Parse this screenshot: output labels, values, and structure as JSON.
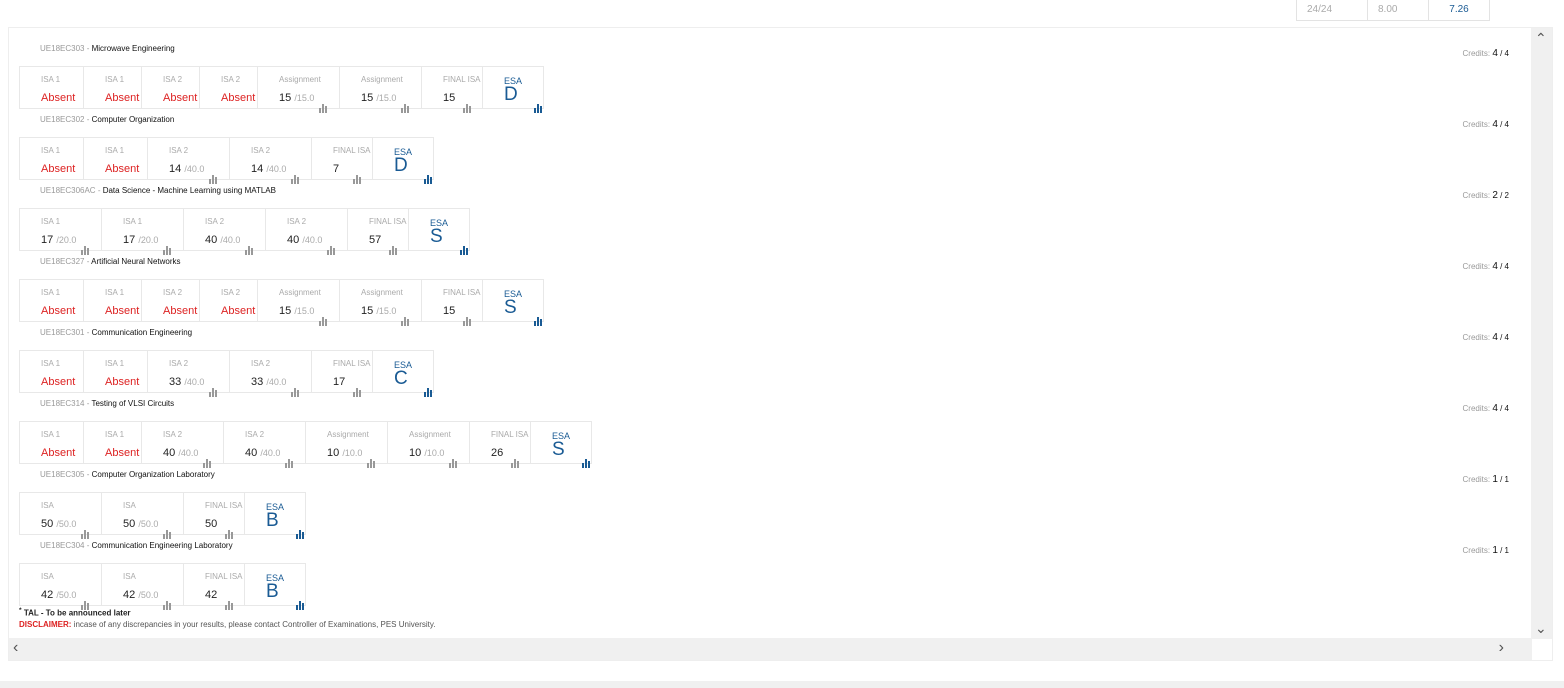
{
  "summary": {
    "credits": "24/24",
    "sgpa_a": "8.00",
    "sgpa_b": "7.26"
  },
  "courses": [
    {
      "code": "UE18EC303",
      "name": "Microwave Engineering",
      "credits_a": "4",
      "credits_b": "4",
      "esa": "D",
      "components": [
        {
          "label": "ISA 1",
          "value": "Absent"
        },
        {
          "label": "ISA 1",
          "value": "Absent"
        },
        {
          "label": "ISA 2",
          "value": "Absent"
        },
        {
          "label": "ISA 2",
          "value": "Absent"
        },
        {
          "label": "Assignment",
          "value": "15",
          "max": "/15.0"
        },
        {
          "label": "Assignment",
          "value": "15",
          "max": "/15.0"
        },
        {
          "label": "FINAL ISA",
          "value": "15"
        }
      ]
    },
    {
      "code": "UE18EC302",
      "name": "Computer Organization",
      "credits_a": "4",
      "credits_b": "4",
      "esa": "D",
      "components": [
        {
          "label": "ISA 1",
          "value": "Absent"
        },
        {
          "label": "ISA 1",
          "value": "Absent"
        },
        {
          "label": "ISA 2",
          "value": "14",
          "max": "/40.0"
        },
        {
          "label": "ISA 2",
          "value": "14",
          "max": "/40.0"
        },
        {
          "label": "FINAL ISA",
          "value": "7"
        }
      ]
    },
    {
      "code": "UE18EC306AC",
      "name": "Data Science - Machine Learning using MATLAB",
      "credits_a": "2",
      "credits_b": "2",
      "esa": "S",
      "components": [
        {
          "label": "ISA 1",
          "value": "17",
          "max": "/20.0"
        },
        {
          "label": "ISA 1",
          "value": "17",
          "max": "/20.0"
        },
        {
          "label": "ISA 2",
          "value": "40",
          "max": "/40.0"
        },
        {
          "label": "ISA 2",
          "value": "40",
          "max": "/40.0"
        },
        {
          "label": "FINAL ISA",
          "value": "57"
        }
      ]
    },
    {
      "code": "UE18EC327",
      "name": "Artificial Neural Networks",
      "credits_a": "4",
      "credits_b": "4",
      "esa": "S",
      "components": [
        {
          "label": "ISA 1",
          "value": "Absent"
        },
        {
          "label": "ISA 1",
          "value": "Absent"
        },
        {
          "label": "ISA 2",
          "value": "Absent"
        },
        {
          "label": "ISA 2",
          "value": "Absent"
        },
        {
          "label": "Assignment",
          "value": "15",
          "max": "/15.0"
        },
        {
          "label": "Assignment",
          "value": "15",
          "max": "/15.0"
        },
        {
          "label": "FINAL ISA",
          "value": "15"
        }
      ]
    },
    {
      "code": "UE18EC301",
      "name": "Communication Engineering",
      "credits_a": "4",
      "credits_b": "4",
      "esa": "C",
      "components": [
        {
          "label": "ISA 1",
          "value": "Absent"
        },
        {
          "label": "ISA 1",
          "value": "Absent"
        },
        {
          "label": "ISA 2",
          "value": "33",
          "max": "/40.0"
        },
        {
          "label": "ISA 2",
          "value": "33",
          "max": "/40.0"
        },
        {
          "label": "FINAL ISA",
          "value": "17"
        }
      ]
    },
    {
      "code": "UE18EC314",
      "name": "Testing of VLSI Circuits",
      "credits_a": "4",
      "credits_b": "4",
      "esa": "S",
      "components": [
        {
          "label": "ISA 1",
          "value": "Absent"
        },
        {
          "label": "ISA 1",
          "value": "Absent"
        },
        {
          "label": "ISA 2",
          "value": "40",
          "max": "/40.0"
        },
        {
          "label": "ISA 2",
          "value": "40",
          "max": "/40.0"
        },
        {
          "label": "Assignment",
          "value": "10",
          "max": "/10.0"
        },
        {
          "label": "Assignment",
          "value": "10",
          "max": "/10.0"
        },
        {
          "label": "FINAL ISA",
          "value": "26"
        }
      ]
    },
    {
      "code": "UE18EC305",
      "name": "Computer Organization Laboratory",
      "credits_a": "1",
      "credits_b": "1",
      "esa": "B",
      "components": [
        {
          "label": "ISA",
          "value": "50",
          "max": "/50.0"
        },
        {
          "label": "ISA",
          "value": "50",
          "max": "/50.0"
        },
        {
          "label": "FINAL ISA",
          "value": "50"
        }
      ]
    },
    {
      "code": "UE18EC304",
      "name": "Communication Engineering Laboratory",
      "credits_a": "1",
      "credits_b": "1",
      "esa": "B",
      "components": [
        {
          "label": "ISA",
          "value": "42",
          "max": "/50.0"
        },
        {
          "label": "ISA",
          "value": "42",
          "max": "/50.0"
        },
        {
          "label": "FINAL ISA",
          "value": "42"
        }
      ]
    }
  ],
  "labels": {
    "credits": "Credits:",
    "esa": "ESA",
    "separator": " - ",
    "slash": " / "
  },
  "footer": {
    "tal_mark": "*",
    "tal": "TAL - To be announced later",
    "disclaimer_label": "DISCLAIMER:",
    "disclaimer_text": "incase of any discrepancies in your results, please contact Controller of Examinations, PES University."
  },
  "colors": {
    "absent": "#dd2222",
    "accent": "#1a5b94",
    "muted": "#aaaaaa"
  }
}
